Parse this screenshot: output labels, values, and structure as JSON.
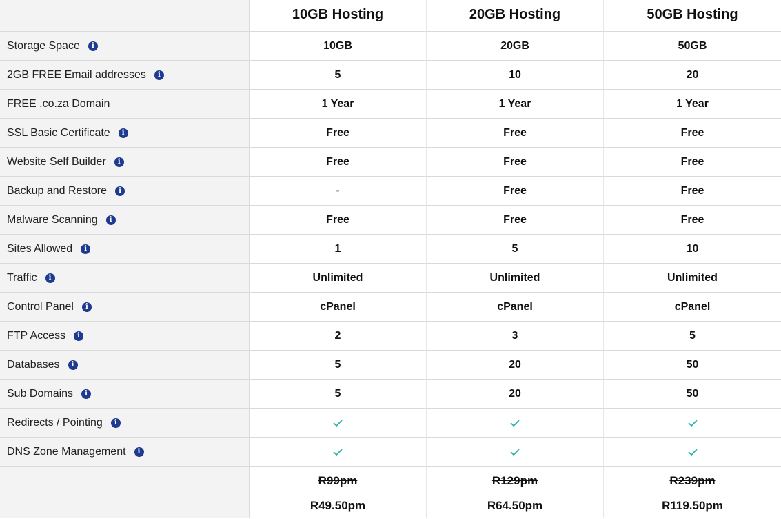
{
  "header": {
    "plans": [
      "10GB Hosting",
      "20GB Hosting",
      "50GB Hosting"
    ]
  },
  "rows": [
    {
      "label": "Storage Space",
      "info": true,
      "values": [
        "10GB",
        "20GB",
        "50GB"
      ]
    },
    {
      "label": "2GB FREE Email addresses",
      "info": true,
      "values": [
        "5",
        "10",
        "20"
      ]
    },
    {
      "label": "FREE .co.za Domain",
      "info": false,
      "values": [
        "1 Year",
        "1 Year",
        "1 Year"
      ]
    },
    {
      "label": "SSL Basic Certificate",
      "info": true,
      "values": [
        "Free",
        "Free",
        "Free"
      ]
    },
    {
      "label": "Website Self Builder",
      "info": true,
      "values": [
        "Free",
        "Free",
        "Free"
      ]
    },
    {
      "label": "Backup and Restore",
      "info": true,
      "values": [
        "-",
        "Free",
        "Free"
      ]
    },
    {
      "label": "Malware Scanning",
      "info": true,
      "values": [
        "Free",
        "Free",
        "Free"
      ]
    },
    {
      "label": "Sites Allowed",
      "info": true,
      "values": [
        "1",
        "5",
        "10"
      ]
    },
    {
      "label": "Traffic",
      "info": true,
      "values": [
        "Unlimited",
        "Unlimited",
        "Unlimited"
      ]
    },
    {
      "label": "Control Panel",
      "info": true,
      "values": [
        "cPanel",
        "cPanel",
        "cPanel"
      ]
    },
    {
      "label": "FTP Access",
      "info": true,
      "values": [
        "2",
        "3",
        "5"
      ]
    },
    {
      "label": "Databases",
      "info": true,
      "values": [
        "5",
        "20",
        "50"
      ]
    },
    {
      "label": "Sub Domains",
      "info": true,
      "values": [
        "5",
        "20",
        "50"
      ]
    },
    {
      "label": "Redirects / Pointing",
      "info": true,
      "values": [
        "check",
        "check",
        "check"
      ]
    },
    {
      "label": "DNS Zone Management",
      "info": true,
      "values": [
        "check",
        "check",
        "check"
      ]
    }
  ],
  "pricing": [
    {
      "old": "R99pm",
      "new": "R49.50pm"
    },
    {
      "old": "R129pm",
      "new": "R64.50pm"
    },
    {
      "old": "R239pm",
      "new": "R119.50pm"
    }
  ],
  "icons": {
    "info": "info-icon",
    "check": "check-icon"
  },
  "colors": {
    "info_icon": "#1f3b8f",
    "check": "#2bb5a0",
    "label_bg": "#f3f3f3"
  }
}
